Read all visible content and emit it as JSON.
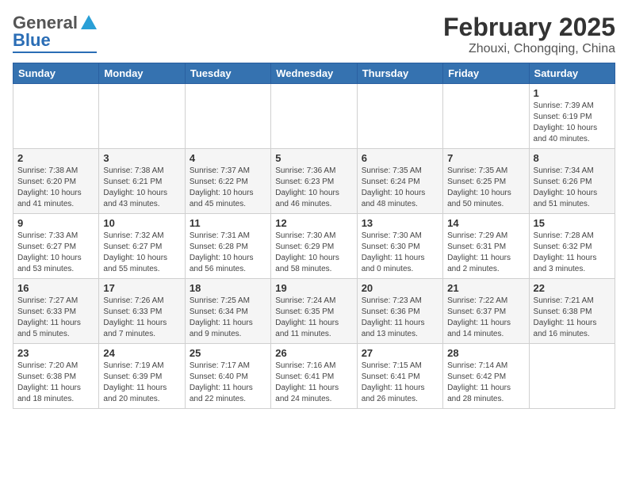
{
  "header": {
    "logo_general": "General",
    "logo_blue": "Blue",
    "title": "February 2025",
    "subtitle": "Zhouxi, Chongqing, China"
  },
  "days_of_week": [
    "Sunday",
    "Monday",
    "Tuesday",
    "Wednesday",
    "Thursday",
    "Friday",
    "Saturday"
  ],
  "weeks": [
    [
      {
        "day": "",
        "info": ""
      },
      {
        "day": "",
        "info": ""
      },
      {
        "day": "",
        "info": ""
      },
      {
        "day": "",
        "info": ""
      },
      {
        "day": "",
        "info": ""
      },
      {
        "day": "",
        "info": ""
      },
      {
        "day": "1",
        "info": "Sunrise: 7:39 AM\nSunset: 6:19 PM\nDaylight: 10 hours and 40 minutes."
      }
    ],
    [
      {
        "day": "2",
        "info": "Sunrise: 7:38 AM\nSunset: 6:20 PM\nDaylight: 10 hours and 41 minutes."
      },
      {
        "day": "3",
        "info": "Sunrise: 7:38 AM\nSunset: 6:21 PM\nDaylight: 10 hours and 43 minutes."
      },
      {
        "day": "4",
        "info": "Sunrise: 7:37 AM\nSunset: 6:22 PM\nDaylight: 10 hours and 45 minutes."
      },
      {
        "day": "5",
        "info": "Sunrise: 7:36 AM\nSunset: 6:23 PM\nDaylight: 10 hours and 46 minutes."
      },
      {
        "day": "6",
        "info": "Sunrise: 7:35 AM\nSunset: 6:24 PM\nDaylight: 10 hours and 48 minutes."
      },
      {
        "day": "7",
        "info": "Sunrise: 7:35 AM\nSunset: 6:25 PM\nDaylight: 10 hours and 50 minutes."
      },
      {
        "day": "8",
        "info": "Sunrise: 7:34 AM\nSunset: 6:26 PM\nDaylight: 10 hours and 51 minutes."
      }
    ],
    [
      {
        "day": "9",
        "info": "Sunrise: 7:33 AM\nSunset: 6:27 PM\nDaylight: 10 hours and 53 minutes."
      },
      {
        "day": "10",
        "info": "Sunrise: 7:32 AM\nSunset: 6:27 PM\nDaylight: 10 hours and 55 minutes."
      },
      {
        "day": "11",
        "info": "Sunrise: 7:31 AM\nSunset: 6:28 PM\nDaylight: 10 hours and 56 minutes."
      },
      {
        "day": "12",
        "info": "Sunrise: 7:30 AM\nSunset: 6:29 PM\nDaylight: 10 hours and 58 minutes."
      },
      {
        "day": "13",
        "info": "Sunrise: 7:30 AM\nSunset: 6:30 PM\nDaylight: 11 hours and 0 minutes."
      },
      {
        "day": "14",
        "info": "Sunrise: 7:29 AM\nSunset: 6:31 PM\nDaylight: 11 hours and 2 minutes."
      },
      {
        "day": "15",
        "info": "Sunrise: 7:28 AM\nSunset: 6:32 PM\nDaylight: 11 hours and 3 minutes."
      }
    ],
    [
      {
        "day": "16",
        "info": "Sunrise: 7:27 AM\nSunset: 6:33 PM\nDaylight: 11 hours and 5 minutes."
      },
      {
        "day": "17",
        "info": "Sunrise: 7:26 AM\nSunset: 6:33 PM\nDaylight: 11 hours and 7 minutes."
      },
      {
        "day": "18",
        "info": "Sunrise: 7:25 AM\nSunset: 6:34 PM\nDaylight: 11 hours and 9 minutes."
      },
      {
        "day": "19",
        "info": "Sunrise: 7:24 AM\nSunset: 6:35 PM\nDaylight: 11 hours and 11 minutes."
      },
      {
        "day": "20",
        "info": "Sunrise: 7:23 AM\nSunset: 6:36 PM\nDaylight: 11 hours and 13 minutes."
      },
      {
        "day": "21",
        "info": "Sunrise: 7:22 AM\nSunset: 6:37 PM\nDaylight: 11 hours and 14 minutes."
      },
      {
        "day": "22",
        "info": "Sunrise: 7:21 AM\nSunset: 6:38 PM\nDaylight: 11 hours and 16 minutes."
      }
    ],
    [
      {
        "day": "23",
        "info": "Sunrise: 7:20 AM\nSunset: 6:38 PM\nDaylight: 11 hours and 18 minutes."
      },
      {
        "day": "24",
        "info": "Sunrise: 7:19 AM\nSunset: 6:39 PM\nDaylight: 11 hours and 20 minutes."
      },
      {
        "day": "25",
        "info": "Sunrise: 7:17 AM\nSunset: 6:40 PM\nDaylight: 11 hours and 22 minutes."
      },
      {
        "day": "26",
        "info": "Sunrise: 7:16 AM\nSunset: 6:41 PM\nDaylight: 11 hours and 24 minutes."
      },
      {
        "day": "27",
        "info": "Sunrise: 7:15 AM\nSunset: 6:41 PM\nDaylight: 11 hours and 26 minutes."
      },
      {
        "day": "28",
        "info": "Sunrise: 7:14 AM\nSunset: 6:42 PM\nDaylight: 11 hours and 28 minutes."
      },
      {
        "day": "",
        "info": ""
      }
    ]
  ]
}
